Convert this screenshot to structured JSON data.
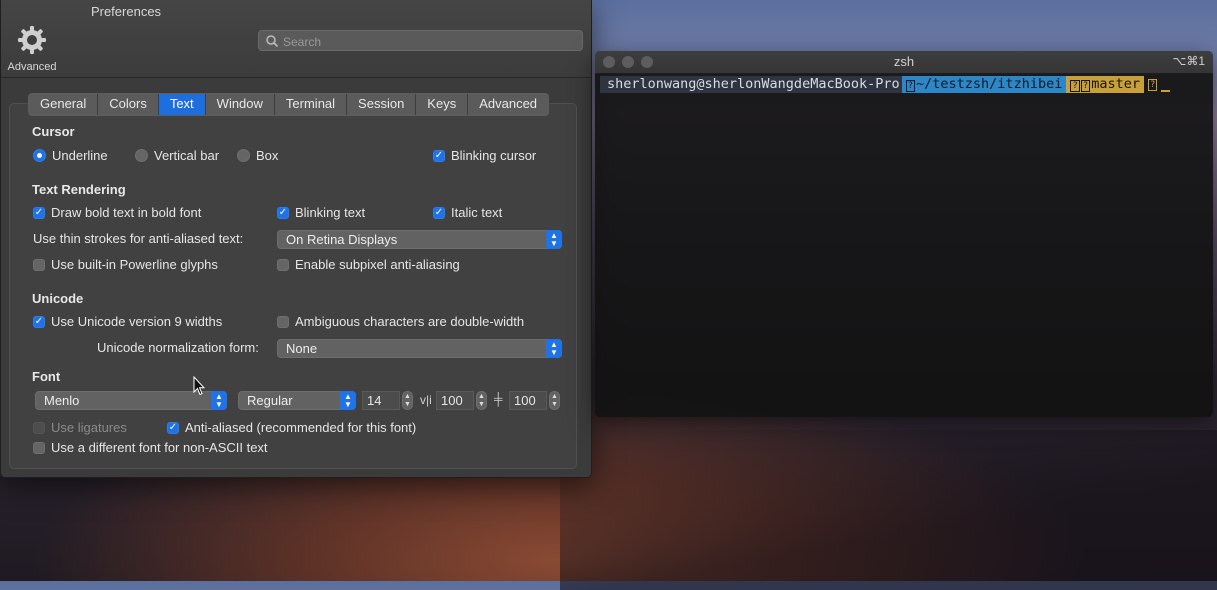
{
  "prefs": {
    "title": "Preferences",
    "toolbar_item": "Advanced",
    "search_placeholder": "Search",
    "tabs": [
      "General",
      "Colors",
      "Text",
      "Window",
      "Terminal",
      "Session",
      "Keys",
      "Advanced"
    ],
    "active_tab": "Text",
    "cursor": {
      "heading": "Cursor",
      "options": [
        "Underline",
        "Vertical bar",
        "Box"
      ],
      "selected": "Underline",
      "blinking_label": "Blinking cursor",
      "blinking_checked": true
    },
    "text_rendering": {
      "heading": "Text Rendering",
      "bold_label": "Draw bold text in bold font",
      "blink_text_label": "Blinking text",
      "italic_label": "Italic text",
      "thin_strokes_label": "Use thin strokes for anti-aliased text:",
      "thin_strokes_value": "On Retina Displays",
      "powerline_label": "Use built-in Powerline glyphs",
      "subpixel_label": "Enable subpixel anti-aliasing"
    },
    "unicode": {
      "heading": "Unicode",
      "v9_label": "Use Unicode version 9 widths",
      "ambiguous_label": "Ambiguous characters are double-width",
      "normalization_label": "Unicode normalization form:",
      "normalization_value": "None"
    },
    "font": {
      "heading": "Font",
      "family": "Menlo",
      "style": "Regular",
      "size": "14",
      "h_spacing_glyph": "v|i",
      "h_spacing": "100",
      "v_spacing_glyph": "╪",
      "v_spacing": "100",
      "ligatures_label": "Use ligatures",
      "antialiased_label": "Anti-aliased (recommended for this font)",
      "non_ascii_label": "Use a different font for non-ASCII text"
    }
  },
  "terminal": {
    "title": "zsh",
    "shortcut": "⌥⌘1",
    "user_host": "sherlonwang@sherlonWangdeMacBook-Pro",
    "dir": "~/testzsh/itzhibei",
    "branch": "master",
    "pua_glyph": "?"
  },
  "colors": {
    "accent": "#1f73e6",
    "dir_segment": "#2d86c6",
    "git_segment": "#c8a03a"
  }
}
